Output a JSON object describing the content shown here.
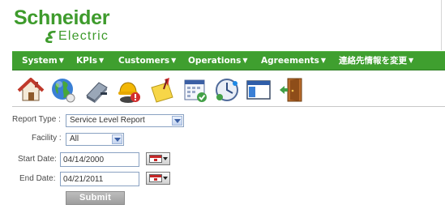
{
  "brand": {
    "name_top": "Schneider",
    "name_bottom": "Electric",
    "color": "#3e9b2c"
  },
  "menu": {
    "background": "#3f9f2f",
    "items": [
      {
        "label": "System"
      },
      {
        "label": "KPIs"
      },
      {
        "label": "Customers"
      },
      {
        "label": "Operations"
      },
      {
        "label": "Agreements"
      },
      {
        "label": "連絡先情報を変更"
      }
    ]
  },
  "toolbar": {
    "icons": [
      "home-icon",
      "globe-icon",
      "server-icon",
      "alert-user-icon",
      "sticky-note-icon",
      "calendar-report-icon",
      "network-clock-icon",
      "window-icon",
      "exit-door-icon"
    ]
  },
  "form": {
    "report_type": {
      "label": "Report Type :",
      "value": "Service Level Report"
    },
    "facility": {
      "label": "Facility :",
      "value": "All"
    },
    "start_date": {
      "label": "Start Date:",
      "value": "04/14/2000"
    },
    "end_date": {
      "label": "End Date:",
      "value": "04/21/2011"
    },
    "submit_label": "Submit"
  }
}
